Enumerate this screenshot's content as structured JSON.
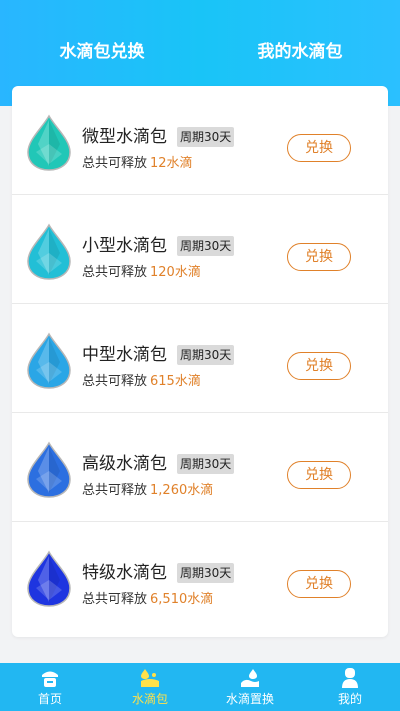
{
  "header": {
    "tab_exchange": "水滴包兑换",
    "tab_mine": "我的水滴包"
  },
  "packages": [
    {
      "name": "微型水滴包",
      "period": "周期30天",
      "release_label": "总共可释放",
      "amount": "12水滴",
      "button": "兑换",
      "color": "#21c7b7",
      "icon": "teal-droplet-gem-icon"
    },
    {
      "name": "小型水滴包",
      "period": "周期30天",
      "release_label": "总共可释放",
      "amount": "120水滴",
      "button": "兑换",
      "color": "#22bfd6",
      "icon": "aqua-droplet-gem-icon"
    },
    {
      "name": "中型水滴包",
      "period": "周期30天",
      "release_label": "总共可释放",
      "amount": "615水滴",
      "button": "兑换",
      "color": "#2aa6e6",
      "icon": "blue-droplet-gem-icon"
    },
    {
      "name": "高级水滴包",
      "period": "周期30天",
      "release_label": "总共可释放",
      "amount": "1,260水滴",
      "button": "兑换",
      "color": "#2c6fe0",
      "icon": "royal-blue-droplet-gem-icon"
    },
    {
      "name": "特级水滴包",
      "period": "周期30天",
      "release_label": "总共可释放",
      "amount": "6,510水滴",
      "button": "兑换",
      "color": "#1e35e0",
      "icon": "deep-blue-droplet-gem-icon"
    }
  ],
  "nav": {
    "items": [
      {
        "label": "首页",
        "icon": "home-icon",
        "active": false
      },
      {
        "label": "水滴包",
        "icon": "water-pack-icon",
        "active": true
      },
      {
        "label": "水滴置换",
        "icon": "water-exchange-icon",
        "active": false
      },
      {
        "label": "我的",
        "icon": "profile-icon",
        "active": false
      }
    ]
  },
  "colors": {
    "header": "#29b6ff",
    "nav": "#22b7f2",
    "accent": "#e0812a",
    "active_nav": "#ffe14a"
  }
}
